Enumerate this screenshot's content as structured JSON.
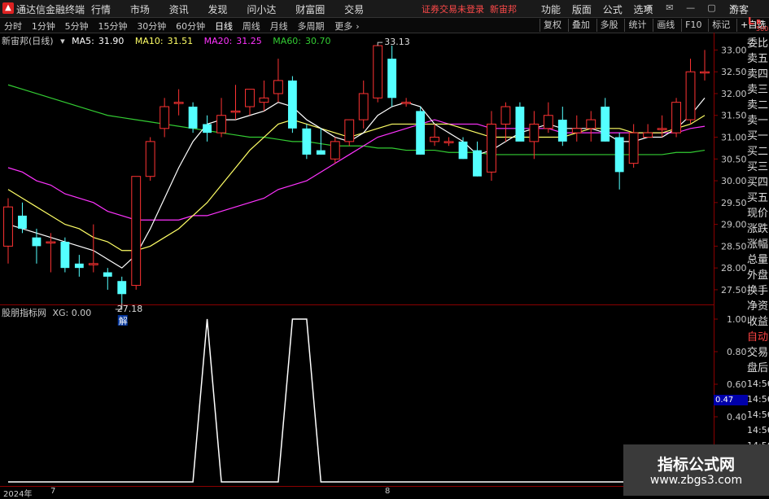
{
  "window": {
    "app_title": "通达信金融终端",
    "menu": [
      "行情",
      "市场",
      "资讯",
      "发现",
      "问小达",
      "财富圈",
      "交易"
    ],
    "login_tip": "证券交易未登录",
    "stock_short": "新宙邦",
    "right_menu": [
      "功能",
      "版面",
      "公式",
      "选项"
    ],
    "guest": "游客",
    "lr_top": "L",
    "lr_r": "R",
    "lr_num": "500"
  },
  "toolbar": {
    "periods": [
      "分时",
      "1分钟",
      "5分钟",
      "15分钟",
      "30分钟",
      "60分钟",
      "日线",
      "周线",
      "月线",
      "多周期",
      "更多"
    ],
    "active_period": "日线",
    "more_arrow": "›",
    "right_tools": [
      "复权",
      "叠加",
      "多股",
      "统计",
      "画线",
      "F10",
      "标记",
      "+自选",
      "返回"
    ]
  },
  "main_chart": {
    "stock_label": "新宙邦(日线)",
    "ma": [
      {
        "label": "MA5:",
        "value": "31.90",
        "color": "#ffffff"
      },
      {
        "label": "MA10:",
        "value": "31.51",
        "color": "#ffff66"
      },
      {
        "label": "MA20:",
        "value": "31.25",
        "color": "#ff33ff"
      },
      {
        "label": "MA60:",
        "value": "30.70",
        "color": "#33cc33"
      }
    ],
    "y_ticks": [
      "33.00",
      "32.50",
      "32.00",
      "31.50",
      "31.00",
      "30.50",
      "30.00",
      "29.50",
      "29.00",
      "28.50",
      "28.00",
      "27.50"
    ],
    "high_label": "33.13",
    "low_label": "27.18",
    "jie_label": "解",
    "colors": {
      "up": "#ff3333",
      "down": "#54ffff",
      "ma5": "#ffffff",
      "ma10": "#ffff66",
      "ma20": "#ff33ff",
      "ma60": "#33cc33"
    }
  },
  "chart_data": [
    {
      "type": "candlestick",
      "title": "新宙邦(日线)",
      "ylim": [
        27.2,
        33.4
      ],
      "candles": [
        {
          "o": 28.5,
          "h": 29.6,
          "l": 28.1,
          "c": 29.4
        },
        {
          "o": 29.2,
          "h": 29.5,
          "l": 28.8,
          "c": 28.9
        },
        {
          "o": 28.7,
          "h": 28.9,
          "l": 28.1,
          "c": 28.5
        },
        {
          "o": 28.6,
          "h": 28.8,
          "l": 27.9,
          "c": 28.6
        },
        {
          "o": 28.6,
          "h": 28.7,
          "l": 27.9,
          "c": 28.0
        },
        {
          "o": 28.1,
          "h": 28.3,
          "l": 27.8,
          "c": 28.0
        },
        {
          "o": 28.1,
          "h": 29.0,
          "l": 27.9,
          "c": 28.1
        },
        {
          "o": 27.9,
          "h": 28.0,
          "l": 27.5,
          "c": 27.8
        },
        {
          "o": 27.7,
          "h": 27.8,
          "l": 27.2,
          "c": 27.4
        },
        {
          "o": 27.6,
          "h": 30.1,
          "l": 27.5,
          "c": 30.1
        },
        {
          "o": 30.1,
          "h": 31.0,
          "l": 30.0,
          "c": 30.9
        },
        {
          "o": 31.2,
          "h": 31.9,
          "l": 31.0,
          "c": 31.7
        },
        {
          "o": 31.8,
          "h": 32.1,
          "l": 31.5,
          "c": 31.8
        },
        {
          "o": 31.7,
          "h": 31.8,
          "l": 31.1,
          "c": 31.2
        },
        {
          "o": 31.3,
          "h": 31.5,
          "l": 30.9,
          "c": 31.1
        },
        {
          "o": 31.1,
          "h": 31.9,
          "l": 31.0,
          "c": 31.5
        },
        {
          "o": 31.6,
          "h": 32.2,
          "l": 31.4,
          "c": 31.6
        },
        {
          "o": 31.7,
          "h": 32.1,
          "l": 31.5,
          "c": 32.1
        },
        {
          "o": 31.8,
          "h": 32.3,
          "l": 31.6,
          "c": 31.9
        },
        {
          "o": 32.0,
          "h": 32.8,
          "l": 31.8,
          "c": 32.3
        },
        {
          "o": 32.3,
          "h": 32.4,
          "l": 31.1,
          "c": 31.2
        },
        {
          "o": 31.2,
          "h": 31.3,
          "l": 30.5,
          "c": 30.6
        },
        {
          "o": 30.7,
          "h": 31.2,
          "l": 30.6,
          "c": 30.6
        },
        {
          "o": 30.5,
          "h": 31.0,
          "l": 30.4,
          "c": 30.9
        },
        {
          "o": 30.9,
          "h": 31.4,
          "l": 30.8,
          "c": 31.4
        },
        {
          "o": 31.4,
          "h": 32.3,
          "l": 31.2,
          "c": 32.0
        },
        {
          "o": 31.9,
          "h": 33.1,
          "l": 31.8,
          "c": 33.1
        },
        {
          "o": 32.8,
          "h": 33.1,
          "l": 31.7,
          "c": 31.9
        },
        {
          "o": 31.8,
          "h": 31.9,
          "l": 31.7,
          "c": 31.8
        },
        {
          "o": 31.6,
          "h": 31.7,
          "l": 30.6,
          "c": 30.6
        },
        {
          "o": 30.9,
          "h": 31.3,
          "l": 30.8,
          "c": 31.0
        },
        {
          "o": 30.9,
          "h": 31.0,
          "l": 30.8,
          "c": 30.9
        },
        {
          "o": 30.9,
          "h": 31.0,
          "l": 30.5,
          "c": 30.5
        },
        {
          "o": 30.7,
          "h": 30.9,
          "l": 30.1,
          "c": 30.1
        },
        {
          "o": 30.2,
          "h": 31.6,
          "l": 30.0,
          "c": 31.3
        },
        {
          "o": 31.3,
          "h": 31.8,
          "l": 30.9,
          "c": 31.7
        },
        {
          "o": 31.7,
          "h": 31.8,
          "l": 31.0,
          "c": 30.9
        },
        {
          "o": 30.9,
          "h": 31.6,
          "l": 30.5,
          "c": 31.3
        },
        {
          "o": 31.2,
          "h": 31.8,
          "l": 31.1,
          "c": 31.5
        },
        {
          "o": 31.4,
          "h": 31.7,
          "l": 30.8,
          "c": 30.9
        },
        {
          "o": 31.1,
          "h": 31.5,
          "l": 30.9,
          "c": 31.2
        },
        {
          "o": 31.2,
          "h": 31.6,
          "l": 30.9,
          "c": 31.4
        },
        {
          "o": 31.7,
          "h": 31.9,
          "l": 30.9,
          "c": 30.9
        },
        {
          "o": 31.0,
          "h": 31.1,
          "l": 29.8,
          "c": 30.2
        },
        {
          "o": 30.4,
          "h": 31.3,
          "l": 30.3,
          "c": 31.1
        },
        {
          "o": 31.0,
          "h": 31.3,
          "l": 31.0,
          "c": 31.1
        },
        {
          "o": 31.2,
          "h": 31.5,
          "l": 31.0,
          "c": 31.2
        },
        {
          "o": 31.1,
          "h": 31.9,
          "l": 31.0,
          "c": 31.8
        },
        {
          "o": 31.4,
          "h": 32.8,
          "l": 31.3,
          "c": 32.5
        },
        {
          "o": 32.5,
          "h": 33.0,
          "l": 32.3,
          "c": 32.5
        }
      ],
      "ma5": [
        29.0,
        28.9,
        28.8,
        28.7,
        28.6,
        28.5,
        28.4,
        28.2,
        28.0,
        28.3,
        28.9,
        29.6,
        30.3,
        30.9,
        31.3,
        31.4,
        31.4,
        31.5,
        31.6,
        31.8,
        31.7,
        31.4,
        31.2,
        31.0,
        30.9,
        31.1,
        31.5,
        31.7,
        31.8,
        31.7,
        31.3,
        31.1,
        30.9,
        30.6,
        30.7,
        30.9,
        31.1,
        31.2,
        31.3,
        31.2,
        31.2,
        31.2,
        31.1,
        30.9,
        30.9,
        31.0,
        31.0,
        31.2,
        31.5,
        31.9
      ],
      "ma10": [
        29.8,
        29.6,
        29.4,
        29.2,
        29.0,
        28.9,
        28.7,
        28.6,
        28.4,
        28.4,
        28.5,
        28.7,
        28.9,
        29.2,
        29.5,
        29.9,
        30.3,
        30.7,
        31.0,
        31.3,
        31.4,
        31.3,
        31.2,
        31.1,
        31.0,
        31.1,
        31.2,
        31.3,
        31.3,
        31.3,
        31.3,
        31.3,
        31.2,
        31.1,
        31.0,
        31.0,
        31.0,
        31.0,
        31.0,
        31.0,
        31.1,
        31.2,
        31.2,
        31.2,
        31.1,
        31.1,
        31.1,
        31.2,
        31.3,
        31.5
      ],
      "ma20": [
        30.3,
        30.2,
        30.0,
        29.9,
        29.7,
        29.6,
        29.5,
        29.3,
        29.2,
        29.1,
        29.1,
        29.1,
        29.1,
        29.2,
        29.2,
        29.3,
        29.4,
        29.5,
        29.6,
        29.8,
        29.9,
        30.0,
        30.2,
        30.4,
        30.6,
        30.8,
        31.0,
        31.1,
        31.2,
        31.3,
        31.4,
        31.3,
        31.3,
        31.3,
        31.2,
        31.2,
        31.2,
        31.2,
        31.2,
        31.1,
        31.1,
        31.1,
        31.1,
        31.1,
        31.1,
        31.1,
        31.1,
        31.1,
        31.2,
        31.25
      ],
      "ma60": [
        32.2,
        32.1,
        32.0,
        31.9,
        31.8,
        31.7,
        31.6,
        31.5,
        31.45,
        31.4,
        31.35,
        31.3,
        31.25,
        31.2,
        31.15,
        31.1,
        31.05,
        31.0,
        31.0,
        30.95,
        30.9,
        30.9,
        30.85,
        30.8,
        30.8,
        30.8,
        30.75,
        30.75,
        30.7,
        30.7,
        30.7,
        30.65,
        30.65,
        30.65,
        30.6,
        30.6,
        30.6,
        30.6,
        30.6,
        30.6,
        30.6,
        30.6,
        30.6,
        30.6,
        30.6,
        30.6,
        30.6,
        30.65,
        30.65,
        30.7
      ]
    },
    {
      "type": "line",
      "title": "股朋指标网",
      "series": [
        {
          "name": "XG",
          "values": [
            0,
            0,
            0,
            0,
            0,
            0,
            0,
            0,
            0,
            0,
            0,
            0,
            0,
            0,
            1,
            0,
            0,
            0,
            0,
            0,
            1,
            1,
            0,
            0,
            0,
            0,
            0,
            0,
            0,
            0,
            0,
            0,
            0,
            0,
            0,
            0,
            0,
            0,
            0,
            0,
            0,
            0,
            0,
            0,
            0,
            0,
            0,
            0,
            0,
            0
          ]
        }
      ],
      "ylim": [
        0,
        1
      ]
    }
  ],
  "sub_chart": {
    "label": "股朋指标网",
    "xg_label": "XG: 0.00",
    "y_ticks": [
      "1.00",
      "0.80",
      "0.60",
      "0.40"
    ],
    "current_value": "0.47",
    "line_color": "#ffffff"
  },
  "right_panel": {
    "labels": [
      "委比",
      "卖五",
      "卖四",
      "卖三",
      "卖二",
      "卖一",
      "买一",
      "买二",
      "买三",
      "买四",
      "买五",
      "现价",
      "涨跌",
      "涨幅",
      "总量",
      "外盘",
      "换手",
      "净资",
      "收益",
      "自动",
      "交易",
      "盘后",
      "14:56",
      "14:56",
      "14:56",
      "14:56",
      "14:56",
      "14:56"
    ]
  },
  "bottom_axis": {
    "year": "2024年",
    "m7": "7",
    "m8": "8"
  },
  "watermark": {
    "line1": "指标公式网",
    "line2": "www.zbgs3.com"
  }
}
